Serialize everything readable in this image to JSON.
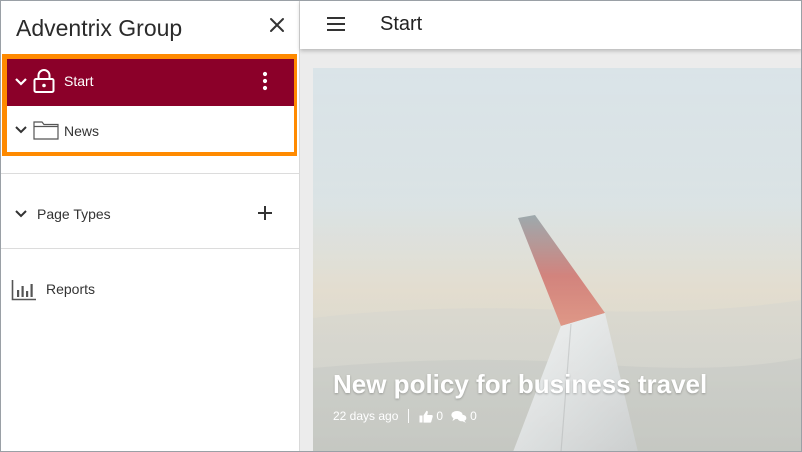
{
  "sidebar": {
    "title": "Adventrix Group",
    "tree": {
      "start_label": "Start",
      "news_label": "News"
    },
    "page_types_label": "Page Types",
    "reports_label": "Reports"
  },
  "topbar": {
    "title": "Start"
  },
  "card": {
    "title": "New policy for business travel",
    "time_ago": "22 days ago",
    "likes": "0",
    "comments": "0"
  },
  "colors": {
    "selected_row": "#8b0029",
    "highlight_border": "#ff8a00"
  },
  "icons": [
    "close-icon",
    "chevron-down-icon",
    "lock-icon",
    "folder-icon",
    "more-vertical-icon",
    "plus-icon",
    "bar-chart-icon",
    "menu-icon",
    "thumbs-up-icon",
    "comments-icon"
  ]
}
